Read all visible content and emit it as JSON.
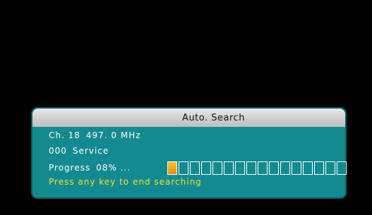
{
  "dialog": {
    "title": "Auto. Search",
    "channel_label": "Ch. 18",
    "frequency": "497. 0 MHz",
    "service_count": "000",
    "service_label": "Service",
    "progress_label": "Progress",
    "progress_text": "08% ...",
    "progress_percent": 8,
    "progress_total_cells": 16,
    "progress_filled_cells": 1,
    "hint": "Press any key to end searching"
  },
  "colors": {
    "background": "#000000",
    "panel": "#138a8f",
    "title_bar": "#d0d0d0",
    "text": "#ffffff",
    "hint_text": "#f2e23a",
    "progress_fill": "#f2a822"
  }
}
